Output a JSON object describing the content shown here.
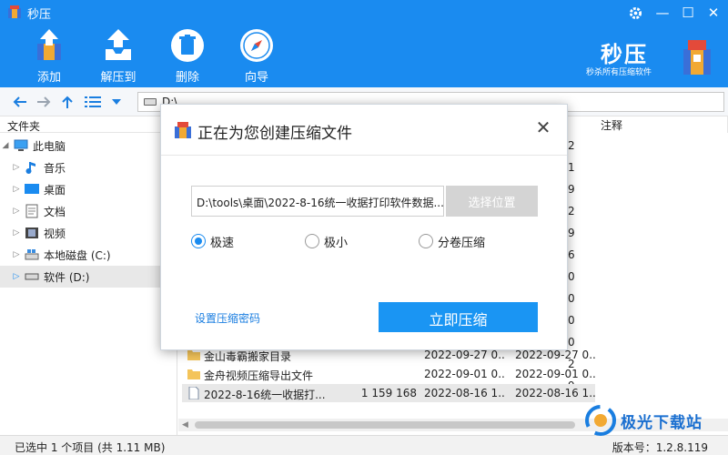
{
  "app": {
    "title": "秒压"
  },
  "window_controls": {
    "settings": "gear-icon",
    "minimize": "—",
    "maximize": "☐",
    "close": "✕"
  },
  "toolbar": {
    "add_label": "添加",
    "extract_label": "解压到",
    "delete_label": "删除",
    "wizard_label": "向导"
  },
  "brand": {
    "name": "秒压",
    "slogan": "秒杀所有压缩软件"
  },
  "address": {
    "path": "D:\\"
  },
  "tree": {
    "header": "文件夹",
    "items": [
      {
        "label": "此电脑"
      },
      {
        "label": "音乐"
      },
      {
        "label": "桌面"
      },
      {
        "label": "文档"
      },
      {
        "label": "视频"
      },
      {
        "label": "本地磁盘 (C:)"
      },
      {
        "label": "软件 (D:)"
      }
    ]
  },
  "filelist": {
    "columns": {
      "comment": "注释"
    },
    "peek_values": [
      "2",
      "1",
      "9",
      "2",
      "9",
      "6",
      "0",
      "0",
      "0",
      "0",
      "2",
      "9"
    ],
    "rows": [
      {
        "name": "金山毒霸搬家目录",
        "size": "",
        "modified": "2022-09-27 0...",
        "created": "2022-09-27 0..."
      },
      {
        "name": "金舟视频压缩导出文件",
        "size": "",
        "modified": "2022-09-01 0...",
        "created": "2022-09-01 0..."
      },
      {
        "name": "2022-8-16统一收据打...",
        "size": "1 159 168",
        "modified": "2022-08-16 1...",
        "created": "2022-08-16 1..."
      }
    ]
  },
  "status": {
    "selection": "已选中 1 个项目 (共 1.11 MB)",
    "version": "版本号：1.2.8.119"
  },
  "watermark": {
    "text": "极光下载站"
  },
  "dialog": {
    "title": "正在为您创建压缩文件",
    "target_path": "D:\\tools\\桌面\\2022-8-16统一收据打印软件数据...",
    "choose_label": "选择位置",
    "options": [
      {
        "label": "极速",
        "selected": true
      },
      {
        "label": "极小",
        "selected": false
      },
      {
        "label": "分卷压缩",
        "selected": false
      }
    ],
    "password_link": "设置压缩密码",
    "compress_label": "立即压缩"
  }
}
